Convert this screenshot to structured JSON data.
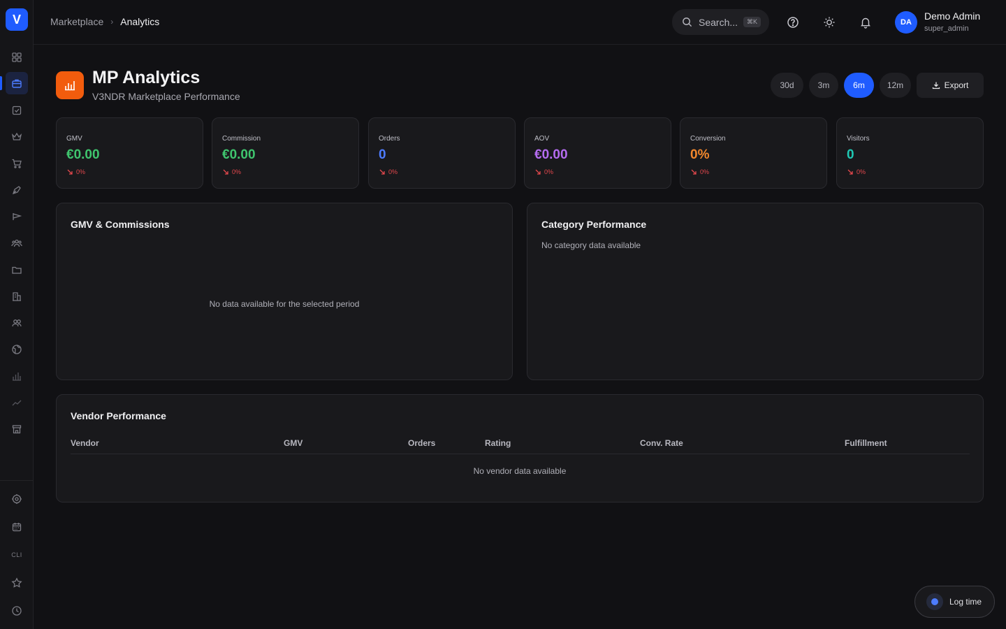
{
  "sidebar": {
    "logo": "V",
    "icons": [
      "grid-icon",
      "briefcase-icon",
      "check-square-icon",
      "crown-icon",
      "cart-icon",
      "pen-tool-icon",
      "megaphone-icon",
      "users-icon",
      "folder-icon",
      "building-icon",
      "team-icon",
      "globe-icon",
      "bar-chart-icon",
      "trend-icon",
      "store-icon"
    ],
    "bottom": {
      "cli": "CLI"
    }
  },
  "header": {
    "breadcrumb": {
      "parent": "Marketplace",
      "current": "Analytics"
    },
    "search": {
      "placeholder": "Search...",
      "shortcut": "⌘K"
    },
    "user": {
      "initials": "DA",
      "name": "Demo Admin",
      "role": "super_admin"
    }
  },
  "page": {
    "title": "MP Analytics",
    "subtitle": "V3NDR Marketplace Performance",
    "ranges": [
      "30d",
      "3m",
      "6m",
      "12m"
    ],
    "active_range": "6m",
    "export_label": "Export"
  },
  "kpis": [
    {
      "label": "GMV",
      "value": "€0.00",
      "delta": "0%",
      "color": "#3fc56e"
    },
    {
      "label": "Commission",
      "value": "€0.00",
      "delta": "0%",
      "color": "#3fc56e"
    },
    {
      "label": "Orders",
      "value": "0",
      "delta": "0%",
      "color": "#4d7cff"
    },
    {
      "label": "AOV",
      "value": "€0.00",
      "delta": "0%",
      "color": "#b56cf0"
    },
    {
      "label": "Conversion",
      "value": "0%",
      "delta": "0%",
      "color": "#f2872c"
    },
    {
      "label": "Visitors",
      "value": "0",
      "delta": "0%",
      "color": "#1fc8b4"
    }
  ],
  "gmv_panel": {
    "title": "GMV & Commissions",
    "empty": "No data available for the selected period"
  },
  "category_panel": {
    "title": "Category Performance",
    "empty": "No category data available"
  },
  "vendor_panel": {
    "title": "Vendor Performance",
    "columns": [
      "Vendor",
      "GMV",
      "Orders",
      "Rating",
      "Conv. Rate",
      "Fulfillment"
    ],
    "empty": "No vendor data available"
  },
  "log_time": {
    "label": "Log time"
  },
  "colors": {
    "accent": "#1f5cff",
    "negative": "#e5484d",
    "brand_orange": "#f25c0d"
  }
}
